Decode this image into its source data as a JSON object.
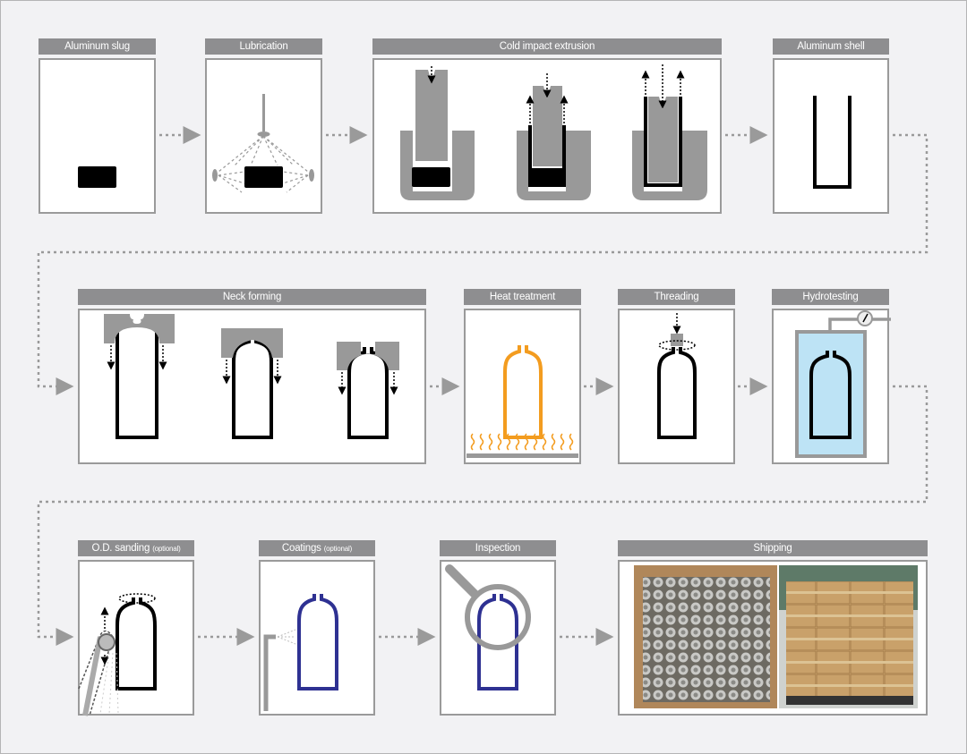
{
  "steps": {
    "slug": {
      "label": "Aluminum slug"
    },
    "lubrication": {
      "label": "Lubrication"
    },
    "extrusion": {
      "label": "Cold impact extrusion"
    },
    "shell": {
      "label": "Aluminum shell"
    },
    "neck": {
      "label": "Neck forming"
    },
    "heat": {
      "label": "Heat treatment"
    },
    "threading": {
      "label": "Threading"
    },
    "hydro": {
      "label": "Hydrotesting"
    },
    "sanding": {
      "label": "O.D. sanding",
      "note": "(optional)"
    },
    "coatings": {
      "label": "Coatings",
      "note": "(optional)"
    },
    "inspection": {
      "label": "Inspection"
    },
    "shipping": {
      "label": "Shipping"
    }
  },
  "colors": {
    "header": "#8e8e90",
    "heat": "#f39c1f",
    "coating": "#2e3192",
    "water": "#bde3f5"
  }
}
